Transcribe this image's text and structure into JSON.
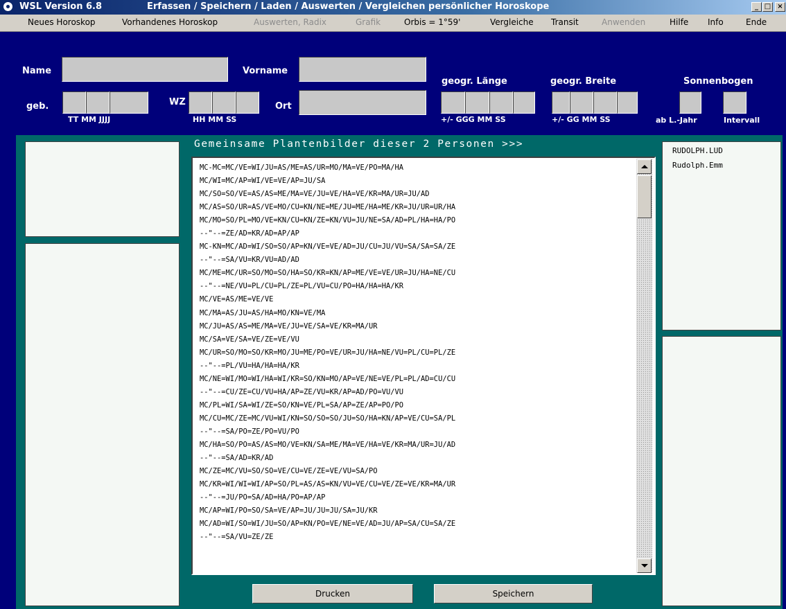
{
  "window": {
    "app_name": "WSL Version 6.8",
    "subtitle": "Erfassen / Speichern / Laden / Auswerten / Vergleichen persönlicher Horoskope",
    "minimize_glyph": "_",
    "maximize_glyph": "□",
    "close_glyph": "×"
  },
  "menu": [
    {
      "label": "Neues Horoskop",
      "enabled": true
    },
    {
      "label": "Vorhandenes Horoskop",
      "enabled": true
    },
    {
      "label": "Auswerten, Radix",
      "enabled": false
    },
    {
      "label": "Grafik",
      "enabled": false
    },
    {
      "label": "Orbis = 1°59'",
      "enabled": true
    },
    {
      "label": "Vergleiche",
      "enabled": true
    },
    {
      "label": "Transit",
      "enabled": true
    },
    {
      "label": "Anwenden",
      "enabled": false
    },
    {
      "label": "Hilfe",
      "enabled": true
    },
    {
      "label": "Info",
      "enabled": true
    },
    {
      "label": "Ende",
      "enabled": true
    }
  ],
  "form": {
    "name_label": "Name",
    "vorname_label": "Vorname",
    "geb_label": "geb.",
    "wz_label": "WZ",
    "ort_label": "Ort",
    "date_sub": "TT  MM   JJJJ",
    "time_sub": "HH  MM  SS",
    "laenge_label": "geogr. Länge",
    "laenge_sub": "+/-  GGG  MM  SS",
    "breite_label": "geogr. Breite",
    "breite_sub": "+/-  GG  MM  SS",
    "sonnenbogen_label": "Sonnenbogen",
    "ab_jahr_label": "ab L.-Jahr",
    "intervall_label": "Intervall",
    "values": {
      "name": "",
      "vorname": "",
      "ort": ""
    }
  },
  "main": {
    "header": "Gemeinsame Plantenbilder dieser 2 Personen >>>",
    "lines": [
      "MC-MC=MC/VE=WI/JU=AS/ME=AS/UR=MO/MA=VE/PO=MA/HA",
      "MC/WI=MC/AP=WI/VE=VE/AP=JU/SA",
      "MC/SO=SO/VE=AS/AS=ME/MA=VE/JU=VE/HA=VE/KR=MA/UR=JU/AD",
      "MC/AS=SO/UR=AS/VE=MO/CU=KN/NE=ME/JU=ME/HA=ME/KR=JU/UR=UR/HA",
      "MC/MO=SO/PL=MO/VE=KN/CU=KN/ZE=KN/VU=JU/NE=SA/AD=PL/HA=HA/PO",
      "--\"--=ZE/AD=KR/AD=AP/AP",
      "MC-KN=MC/AD=WI/SO=SO/AP=KN/VE=VE/AD=JU/CU=JU/VU=SA/SA=SA/ZE",
      "--\"--=SA/VU=KR/VU=AD/AD",
      "MC/ME=MC/UR=SO/MO=SO/HA=SO/KR=KN/AP=ME/VE=VE/UR=JU/HA=NE/CU",
      "--\"--=NE/VU=PL/CU=PL/ZE=PL/VU=CU/PO=HA/HA=HA/KR",
      "MC/VE=AS/ME=VE/VE",
      "MC/MA=AS/JU=AS/HA=MO/KN=VE/MA",
      "MC/JU=AS/AS=ME/MA=VE/JU=VE/SA=VE/KR=MA/UR",
      "MC/SA=VE/SA=VE/ZE=VE/VU",
      "MC/UR=SO/MO=SO/KR=MO/JU=ME/PO=VE/UR=JU/HA=NE/VU=PL/CU=PL/ZE",
      "--\"--=PL/VU=HA/HA=HA/KR",
      "MC/NE=WI/MO=WI/HA=WI/KR=SO/KN=MO/AP=VE/NE=VE/PL=PL/AD=CU/CU",
      "--\"--=CU/ZE=CU/VU=HA/AP=ZE/VU=KR/AP=AD/PO=VU/VU",
      "MC/PL=WI/SA=WI/ZE=SO/KN=VE/PL=SA/AP=ZE/AP=PO/PO",
      "MC/CU=MC/ZE=MC/VU=WI/KN=SO/SO=SO/JU=SO/HA=KN/AP=VE/CU=SA/PL",
      "--\"--=SA/PO=ZE/PO=VU/PO",
      "MC/HA=SO/PO=AS/AS=MO/VE=KN/SA=ME/MA=VE/HA=VE/KR=MA/UR=JU/AD",
      "--\"--=SA/AD=KR/AD",
      "MC/ZE=MC/VU=SO/SO=VE/CU=VE/ZE=VE/VU=SA/PO",
      "MC/KR=WI/WI=WI/AP=SO/PL=AS/AS=KN/VU=VE/CU=VE/ZE=VE/KR=MA/UR",
      "--\"--=JU/PO=SA/AD=HA/PO=AP/AP",
      "MC/AP=WI/PO=SO/SA=VE/AP=JU/JU=JU/SA=JU/KR",
      "MC/AD=WI/SO=WI/JU=SO/AP=KN/PO=VE/NE=VE/AD=JU/AP=SA/CU=SA/ZE",
      "--\"--=SA/VU=ZE/ZE"
    ],
    "print_button": "Drucken",
    "save_button": "Speichern"
  },
  "persons": [
    "RUDOLPH.LUD",
    "Rudolph.Emm"
  ]
}
